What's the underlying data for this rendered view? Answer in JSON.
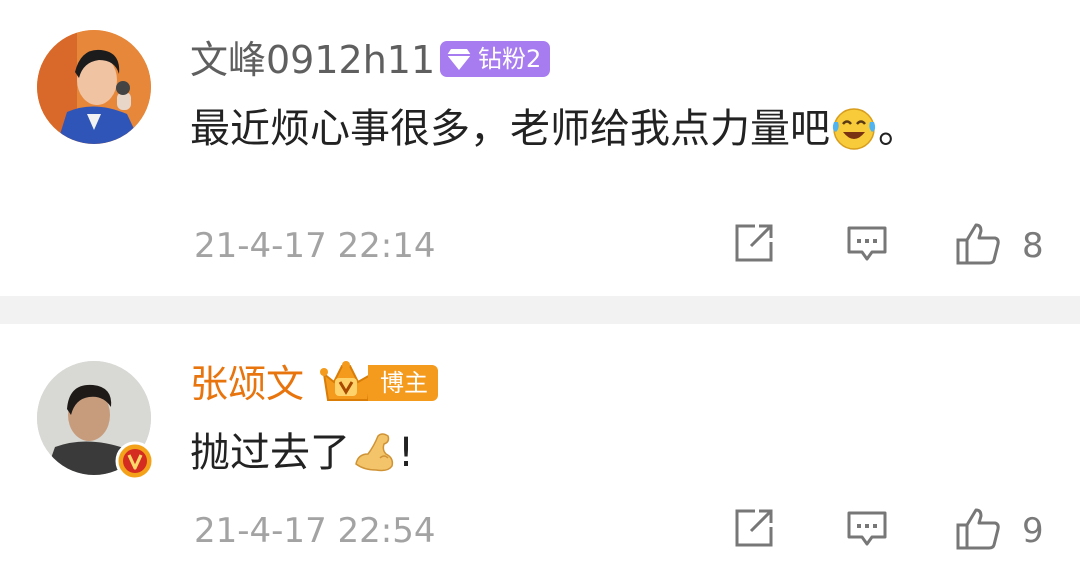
{
  "comments": [
    {
      "username": "文峰0912h11",
      "badge": {
        "icon": "diamond-icon",
        "label": "钻粉2",
        "color": "#a77cf0"
      },
      "content_text": "最近烦心事很多，老师给我点力量吧",
      "content_emoji": "laugh-cry-emoji",
      "content_suffix": "。",
      "timestamp": "21-4-17 22:14",
      "like_count": "8",
      "name_color": "#5f5f5f"
    },
    {
      "username": "张颂文",
      "badge": {
        "icon": "crown-icon",
        "label": "博主",
        "color": "#f49a1c"
      },
      "verified": true,
      "content_text": "抛过去了",
      "content_emoji": "flexed-biceps-emoji",
      "content_suffix": "!",
      "timestamp": "21-4-17 22:54",
      "like_count": "9",
      "name_color": "#e8740d"
    }
  ],
  "actions": {
    "share_icon": "share-icon",
    "reply_icon": "comment-icon",
    "like_icon": "thumbs-up-icon"
  }
}
